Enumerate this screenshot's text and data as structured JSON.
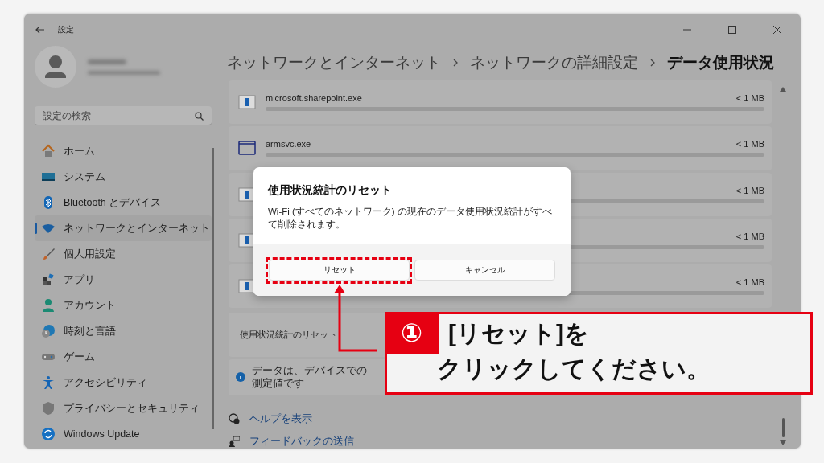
{
  "window": {
    "title": "設定"
  },
  "search": {
    "placeholder": "設定の検索"
  },
  "nav": [
    {
      "label": "ホーム",
      "selected": false
    },
    {
      "label": "システム",
      "selected": false
    },
    {
      "label": "Bluetooth とデバイス",
      "selected": false
    },
    {
      "label": "ネットワークとインターネット",
      "selected": true
    },
    {
      "label": "個人用設定",
      "selected": false
    },
    {
      "label": "アプリ",
      "selected": false
    },
    {
      "label": "アカウント",
      "selected": false
    },
    {
      "label": "時刻と言語",
      "selected": false
    },
    {
      "label": "ゲーム",
      "selected": false
    },
    {
      "label": "アクセシビリティ",
      "selected": false
    },
    {
      "label": "プライバシーとセキュリティ",
      "selected": false
    },
    {
      "label": "Windows Update",
      "selected": false
    }
  ],
  "breadcrumb": [
    "ネットワークとインターネット",
    "ネットワークの詳細設定",
    "データ使用状況"
  ],
  "apps": [
    {
      "name": "microsoft.sharepoint.exe",
      "usage": "< 1 MB",
      "level": 0
    },
    {
      "name": "armsvc.exe",
      "usage": "< 1 MB",
      "level": 0
    },
    {
      "usage": "< 1 MB",
      "level": 0
    },
    {
      "usage": "< 1 MB",
      "level": 0
    },
    {
      "usage": "< 1 MB",
      "level": 0
    }
  ],
  "reset_row": {
    "label": "使用状況統計のリセット"
  },
  "info": {
    "text": "データは、デバイスでの測定値です"
  },
  "links": [
    "ヘルプを表示",
    "フィードバックの送信"
  ],
  "dialog": {
    "title": "使用状況統計のリセット",
    "message": "Wi-Fi (すべてのネットワーク) の現在のデータ使用状況統計がすべて削除されます。",
    "buttons": [
      "リセット",
      "キャンセル"
    ]
  },
  "annotation": {
    "number": "①",
    "lines": [
      "[リセット]を",
      "クリックしてください。"
    ]
  }
}
